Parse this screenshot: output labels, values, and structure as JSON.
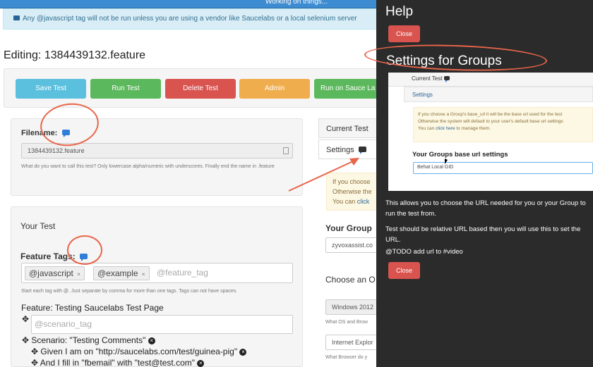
{
  "status_bar": {
    "text": "Working on things..."
  },
  "info_alert": {
    "text": "Any @javascript tag will not be run unless you are using a vendor like Saucelabs or a local selenium server"
  },
  "page_title": "Editing: 1384439132.feature",
  "toolbar": {
    "save": "Save Test",
    "run": "Run Test",
    "delete": "Delete Test",
    "admin": "Admin",
    "sauce": "Run on Sauce La"
  },
  "file": {
    "label": "Filename:",
    "value": "1384439132.feature",
    "help": "What do you want to call this test? Only lowercase alpha/numeric with underscores. Finally end the name in .feature"
  },
  "your_test": {
    "heading": "Your Test",
    "tags_label": "Feature Tags:",
    "tags": [
      "@javascript",
      "@example"
    ],
    "tag_remove": "×",
    "tag_placeholder": "@feature_tag",
    "tags_help": "Start each tag with @. Just separate by comma for more than one tags. Tags can not have spaces.",
    "feature_line": "Feature: Testing Saucelabs Test Page",
    "scenario_placeholder": "@scenario_tag",
    "scenario_line": "Scenario: \"Testing Comments\"",
    "step1": "Given I am on \"http://saucelabs.com/test/guinea-pig\"",
    "step2": "And I fill in \"fbemail\" with \"test@test.com\""
  },
  "right_column": {
    "current_test": "Current Test",
    "settings": "Settings",
    "warn1": "If you choose",
    "warn2": "Otherwise the",
    "warn3a": "You can ",
    "warn3b": "click",
    "your_group": "Your Group",
    "group_value": "zyvoxassist.co",
    "choose": "Choose an O",
    "os_value": "Windows 2012",
    "os_help": "What OS and Brow",
    "browser_value": "Internet Explor",
    "browser_help": "What Browser do y"
  },
  "help_overlay": {
    "title": "Help",
    "close": "Close",
    "settings_title": "Settings for Groups",
    "shot": {
      "current_test": "Current Test",
      "settings_tab": "Settings",
      "warn_line1": "If you choose a Group's base_url it will be the base url used for the test",
      "warn_line2": "Otherwise the system will default to your user's default base url settings",
      "warn_line3a": "You can ",
      "warn_line3b": "click here",
      "warn_line3c": " to manage them.",
      "base_url_heading": "Your Groups base url settings",
      "base_url_value": "Behat Local GID"
    },
    "para1": "This allows you to choose the URL needed for you or your Group to run the test from.",
    "para2": "Test should be relative URL based then you will use this to set the URL.",
    "para3": "@TODO add url to #video"
  },
  "icons": {
    "chat": "comment-icon",
    "move": "move-icon",
    "remove": "remove-circle-icon",
    "annotation_arrow": "arrow-icon"
  },
  "colors": {
    "info": "#5bc0de",
    "success": "#5cb85c",
    "danger": "#d9534f",
    "warning": "#f0ad4e",
    "annotation": "#e8654a"
  }
}
